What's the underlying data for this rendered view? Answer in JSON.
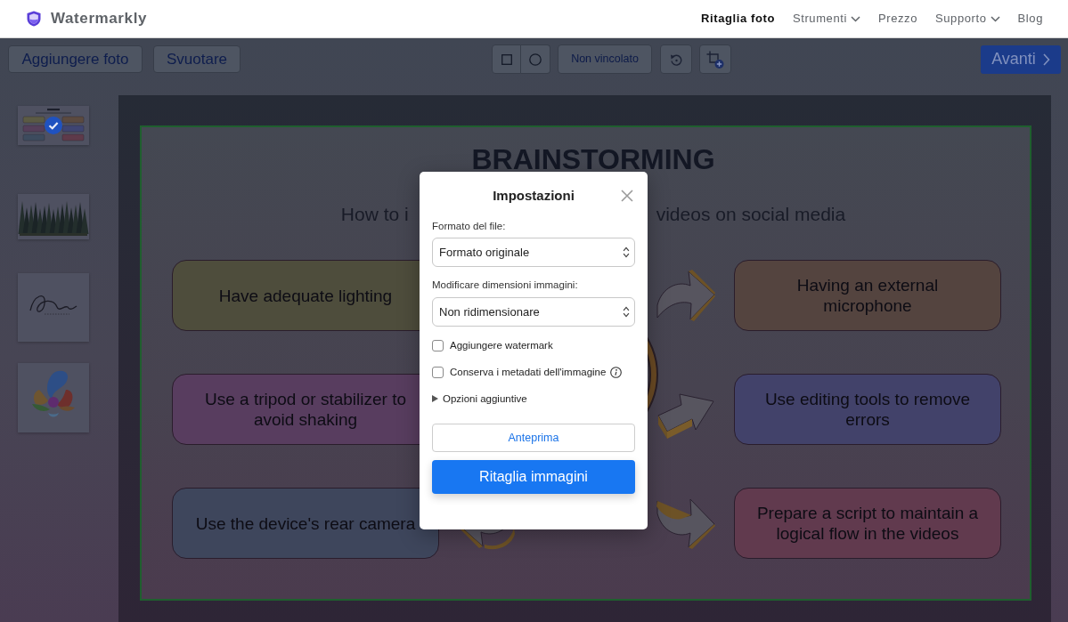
{
  "header": {
    "logo": "Watermarkly",
    "nav": [
      {
        "label": "Ritaglia foto",
        "selected": true,
        "has_menu": false
      },
      {
        "label": "Strumenti",
        "selected": false,
        "has_menu": true
      },
      {
        "label": "Prezzo",
        "selected": false,
        "has_menu": false
      },
      {
        "label": "Supporto",
        "selected": false,
        "has_menu": true
      },
      {
        "label": "Blog",
        "selected": false,
        "has_menu": false
      }
    ]
  },
  "toolbar": {
    "add_button": "Aggiungere foto",
    "clear_button": "Svuotare",
    "shapes": [
      {
        "kind": "rectangle",
        "selected": false
      },
      {
        "kind": "circle",
        "selected": false
      }
    ],
    "aspect_button": "Non vincolato",
    "next_button": "Avanti"
  },
  "thumbnails": [
    {
      "kind": "infographic",
      "selected": true
    },
    {
      "kind": "forest",
      "selected": false
    },
    {
      "kind": "script-logo",
      "selected": false
    },
    {
      "kind": "flower-logo",
      "selected": false
    }
  ],
  "image": {
    "title": "BRAINSTORMING",
    "subtitle": [
      "How to i",
      "videos on social media"
    ],
    "rows": [
      {
        "cards": [
          {
            "text": "Have adequate lighting",
            "color": "#4e4d3c"
          },
          {
            "text": "Having an external microphone",
            "color": "#54443f"
          }
        ]
      },
      {
        "cards": [
          {
            "text": "Use a tripod or stabilizer to avoid shaking",
            "color": "#583d5f"
          },
          {
            "text": "Use editing tools to remove errors",
            "color": "#42426a"
          }
        ]
      },
      {
        "cards": [
          {
            "text": "Use the device's rear camera",
            "color": "#3e465c"
          },
          {
            "text": "Prepare a script to maintain a logical flow in the videos",
            "color": "#613a4e"
          }
        ]
      }
    ]
  },
  "dialog": {
    "title": "Impostazioni",
    "selects": [
      {
        "label": "Formato del file:",
        "value": "Formato originale"
      },
      {
        "label": "Modificare dimensioni immagini:",
        "value": "Non ridimensionare"
      }
    ],
    "options": [
      {
        "label": "Aggiungere watermark",
        "checked": false,
        "info": false
      },
      {
        "label": "Conserva i metadati dell'immagine",
        "checked": false,
        "info": true
      }
    ],
    "more_options": {
      "label": "Opzioni aggiuntive",
      "expanded": false
    },
    "buttons": [
      {
        "label": "Anteprima",
        "kind": "secondary"
      },
      {
        "label": "Ritaglia immagini",
        "kind": "primary"
      }
    ]
  }
}
